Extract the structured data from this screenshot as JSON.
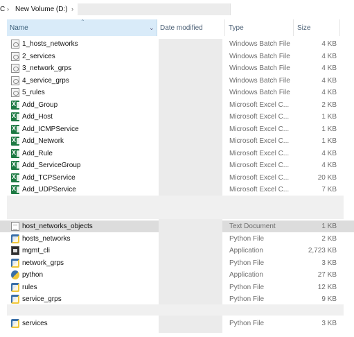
{
  "breadcrumb": {
    "left": "C",
    "separator": "›",
    "current": "New Volume (D:)"
  },
  "columns": {
    "name": "Name",
    "date": "Date modified",
    "type": "Type",
    "size": "Size"
  },
  "files": [
    {
      "name": "1_hosts_networks",
      "type": "Windows Batch File",
      "size": "4 KB",
      "icon": "batch-file-icon",
      "selected": false
    },
    {
      "name": "2_services",
      "type": "Windows Batch File",
      "size": "4 KB",
      "icon": "batch-file-icon",
      "selected": false
    },
    {
      "name": "3_network_grps",
      "type": "Windows Batch File",
      "size": "4 KB",
      "icon": "batch-file-icon",
      "selected": false
    },
    {
      "name": "4_service_grps",
      "type": "Windows Batch File",
      "size": "4 KB",
      "icon": "batch-file-icon",
      "selected": false
    },
    {
      "name": "5_rules",
      "type": "Windows Batch File",
      "size": "4 KB",
      "icon": "batch-file-icon",
      "selected": false
    },
    {
      "name": "Add_Group",
      "type": "Microsoft Excel C...",
      "size": "2 KB",
      "icon": "excel-csv-icon",
      "selected": false
    },
    {
      "name": "Add_Host",
      "type": "Microsoft Excel C...",
      "size": "1 KB",
      "icon": "excel-csv-icon",
      "selected": false
    },
    {
      "name": "Add_ICMPService",
      "type": "Microsoft Excel C...",
      "size": "1 KB",
      "icon": "excel-csv-icon",
      "selected": false
    },
    {
      "name": "Add_Network",
      "type": "Microsoft Excel C...",
      "size": "1 KB",
      "icon": "excel-csv-icon",
      "selected": false
    },
    {
      "name": "Add_Rule",
      "type": "Microsoft Excel C...",
      "size": "4 KB",
      "icon": "excel-csv-icon",
      "selected": false
    },
    {
      "name": "Add_ServiceGroup",
      "type": "Microsoft Excel C...",
      "size": "4 KB",
      "icon": "excel-csv-icon",
      "selected": false
    },
    {
      "name": "Add_TCPService",
      "type": "Microsoft Excel C...",
      "size": "20 KB",
      "icon": "excel-csv-icon",
      "selected": false
    },
    {
      "name": "Add_UDPService",
      "type": "Microsoft Excel C...",
      "size": "7 KB",
      "icon": "excel-csv-icon",
      "selected": false
    },
    {
      "name": "host_networks_objects",
      "type": "Text Document",
      "size": "1 KB",
      "icon": "text-document-icon",
      "selected": true
    },
    {
      "name": "hosts_networks",
      "type": "Python File",
      "size": "2 KB",
      "icon": "python-file-icon",
      "selected": false
    },
    {
      "name": "mgmt_cli",
      "type": "Application",
      "size": "2,723 KB",
      "icon": "application-icon",
      "selected": false
    },
    {
      "name": "network_grps",
      "type": "Python File",
      "size": "3 KB",
      "icon": "python-file-icon",
      "selected": false
    },
    {
      "name": "python",
      "type": "Application",
      "size": "27 KB",
      "icon": "python-app-icon",
      "selected": false
    },
    {
      "name": "rules",
      "type": "Python File",
      "size": "12 KB",
      "icon": "python-file-icon",
      "selected": false
    },
    {
      "name": "service_grps",
      "type": "Python File",
      "size": "9 KB",
      "icon": "python-file-icon",
      "selected": false
    },
    {
      "name": "services",
      "type": "Python File",
      "size": "3 KB",
      "icon": "python-file-icon",
      "selected": false
    }
  ],
  "colors": {
    "header_highlight": "#d9ebf9",
    "selected_row": "#dcdcdc",
    "excel_green": "#1d7a43"
  }
}
